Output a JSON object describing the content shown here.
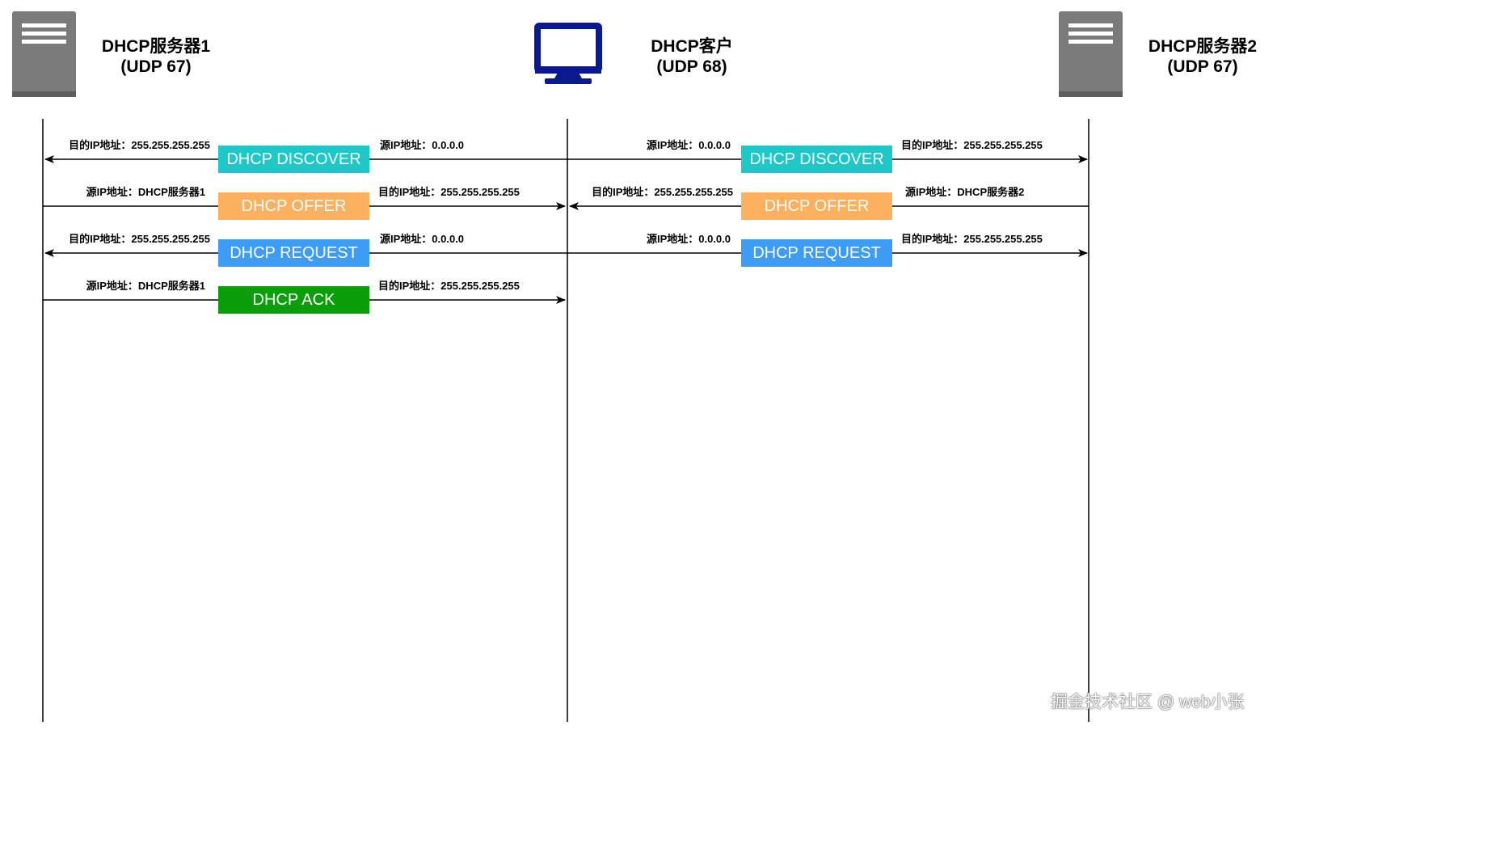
{
  "entities": [
    {
      "id": "server1",
      "icon": "server-icon",
      "name": "DHCP服务器1",
      "port": "(UDP 67)"
    },
    {
      "id": "client",
      "icon": "monitor-icon",
      "name": "DHCP客户",
      "port": "(UDP 68)"
    },
    {
      "id": "server2",
      "icon": "server-icon",
      "name": "DHCP服务器2",
      "port": "(UDP 67)"
    }
  ],
  "messages": {
    "discover_label": "DHCP DISCOVER",
    "offer_label": "DHCP OFFER",
    "request_label": "DHCP REQUEST",
    "ack_label": "DHCP ACK"
  },
  "addresses": {
    "dst_broadcast": "目的IP地址：255.255.255.255",
    "src_zero": "源IP地址：0.0.0.0",
    "src_server1": "源IP地址：DHCP服务器1",
    "src_server2": "源IP地址：DHCP服务器2"
  },
  "colors": {
    "discover": "#1ec8c8",
    "offer": "#fdb15e",
    "request": "#3d9cf5",
    "ack": "#0a9e0a",
    "server_gray": "#7a7a7a",
    "monitor_blue": "#0a1a8e"
  },
  "watermark": "掘金技术社区 @ web小张"
}
